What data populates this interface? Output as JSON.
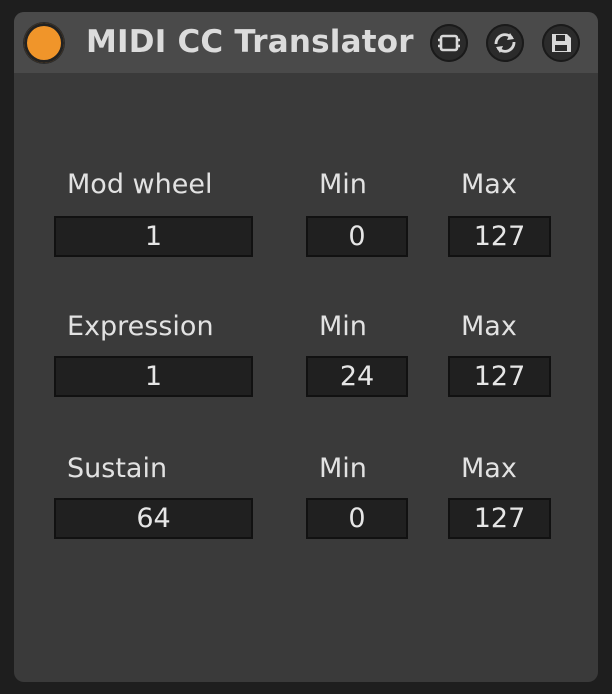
{
  "device": {
    "title": "MIDI CC Translator",
    "accent_color": "#f0952a",
    "buttons": [
      {
        "icon": "frame-icon"
      },
      {
        "icon": "refresh-icon"
      },
      {
        "icon": "save-icon"
      }
    ]
  },
  "rows": [
    {
      "name": "Mod wheel",
      "cc": "1",
      "min_label": "Min",
      "min": "0",
      "max_label": "Max",
      "max": "127"
    },
    {
      "name": "Expression",
      "cc": "1",
      "min_label": "Min",
      "min": "24",
      "max_label": "Max",
      "max": "127"
    },
    {
      "name": "Sustain",
      "cc": "64",
      "min_label": "Min",
      "min": "0",
      "max_label": "Max",
      "max": "127"
    }
  ]
}
